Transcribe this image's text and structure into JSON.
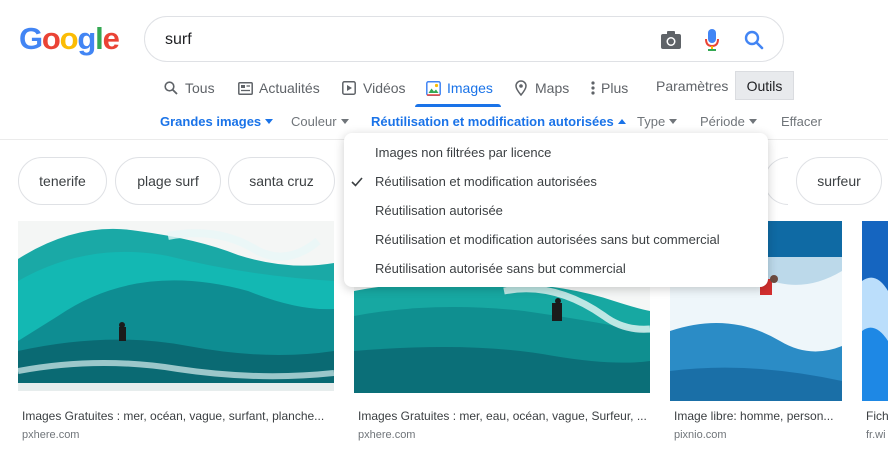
{
  "logo": {
    "letters": [
      "G",
      "o",
      "o",
      "g",
      "l",
      "e"
    ],
    "colors": [
      "#4285F4",
      "#EA4335",
      "#FBBC05",
      "#4285F4",
      "#34A853",
      "#EA4335"
    ]
  },
  "search": {
    "query": "surf",
    "icons": [
      "camera-icon",
      "microphone-icon",
      "search-icon"
    ]
  },
  "tabs": [
    {
      "label": "Tous",
      "icon": "magnifier-icon"
    },
    {
      "label": "Actualités",
      "icon": "newspaper-icon"
    },
    {
      "label": "Vidéos",
      "icon": "play-icon"
    },
    {
      "label": "Images",
      "icon": "image-icon",
      "active": true
    },
    {
      "label": "Maps",
      "icon": "pin-icon"
    },
    {
      "label": "Plus",
      "icon": "dots-icon"
    }
  ],
  "tools": {
    "settings_label": "Paramètres",
    "tools_label": "Outils"
  },
  "filters": {
    "size": "Grandes images",
    "color": "Couleur",
    "usage": "Réutilisation et modification autorisées",
    "type": "Type",
    "period": "Période",
    "clear": "Effacer"
  },
  "usage_menu": {
    "items": [
      "Images non filtrées par licence",
      "Réutilisation et modification autorisées",
      "Réutilisation autorisée",
      "Réutilisation et modification autorisées sans but commercial",
      "Réutilisation autorisée sans but commercial"
    ],
    "selected_index": 1
  },
  "chips": [
    "tenerife",
    "plage surf",
    "santa cruz",
    "surfeur"
  ],
  "results": [
    {
      "title": "Images Gratuites : mer, océan, vague, surfant, planche...",
      "source": "pxhere.com"
    },
    {
      "title": "Images Gratuites : mer, eau, océan, vague, Surfeur, ...",
      "source": "pxhere.com"
    },
    {
      "title": "Image libre: homme, person...",
      "source": "pixnio.com"
    },
    {
      "title": "Fich",
      "source": "fr.wi"
    }
  ],
  "accent_color": "#1a73e8"
}
